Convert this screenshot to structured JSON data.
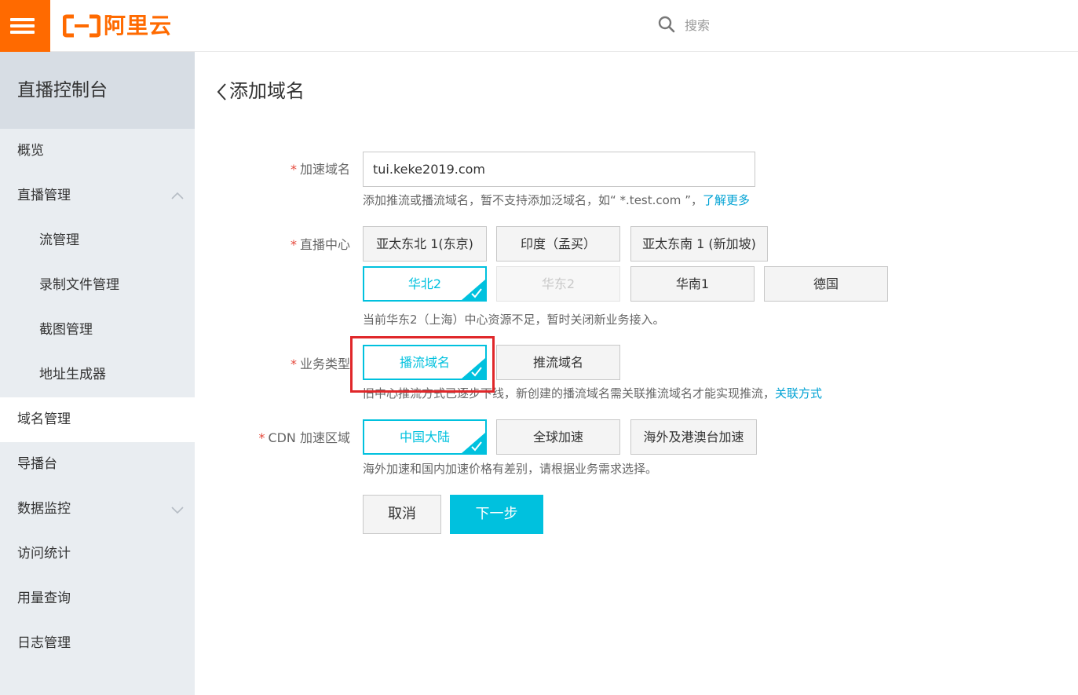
{
  "topbar": {
    "brand": "阿里云",
    "search_placeholder": "搜索",
    "brand_color": "#ff6a00"
  },
  "sidebar": {
    "title": "直播控制台",
    "items": [
      {
        "label": "概览"
      },
      {
        "label": "直播管理"
      },
      {
        "label": "流管理"
      },
      {
        "label": "录制文件管理"
      },
      {
        "label": "截图管理"
      },
      {
        "label": "地址生成器"
      },
      {
        "label": "域名管理"
      },
      {
        "label": "导播台"
      },
      {
        "label": "数据监控"
      },
      {
        "label": "访问统计"
      },
      {
        "label": "用量查询"
      },
      {
        "label": "日志管理"
      }
    ]
  },
  "page": {
    "title": "添加域名"
  },
  "form": {
    "domain": {
      "label": "加速域名",
      "value": "tui.keke2019.com",
      "hint": "添加推流或播流域名，暂不支持添加泛域名，如“ *.test.com ”，",
      "hint_link": "了解更多"
    },
    "center": {
      "label": "直播中心",
      "options": [
        {
          "label": "亚太东北 1(东京)",
          "state": "normal"
        },
        {
          "label": "印度（孟买）",
          "state": "normal"
        },
        {
          "label": "亚太东南 1 (新加坡)",
          "state": "normal"
        },
        {
          "label": "华北2",
          "state": "selected"
        },
        {
          "label": "华东2",
          "state": "disabled"
        },
        {
          "label": "华南1",
          "state": "normal"
        },
        {
          "label": "德国",
          "state": "normal"
        }
      ],
      "hint": "当前华东2（上海）中心资源不足，暂时关闭新业务接入。"
    },
    "business": {
      "label": "业务类型",
      "options": [
        {
          "label": "播流域名",
          "state": "selected"
        },
        {
          "label": "推流域名",
          "state": "normal"
        }
      ],
      "hint": "旧中心推流方式已逐步下线，新创建的播流域名需关联推流域名才能实现推流，",
      "hint_link": "关联方式"
    },
    "cdn": {
      "label": "CDN 加速区域",
      "options": [
        {
          "label": "中国大陆",
          "state": "selected"
        },
        {
          "label": "全球加速",
          "state": "normal"
        },
        {
          "label": "海外及港澳台加速",
          "state": "normal"
        }
      ],
      "hint": "海外加速和国内加速价格有差别，请根据业务需求选择。"
    },
    "required_mark": "*"
  },
  "actions": {
    "cancel": "取消",
    "next": "下一步"
  },
  "colors": {
    "accent": "#00c1de",
    "link": "#00a2d4",
    "required": "#e5473a",
    "highlight": "#e0272a"
  }
}
